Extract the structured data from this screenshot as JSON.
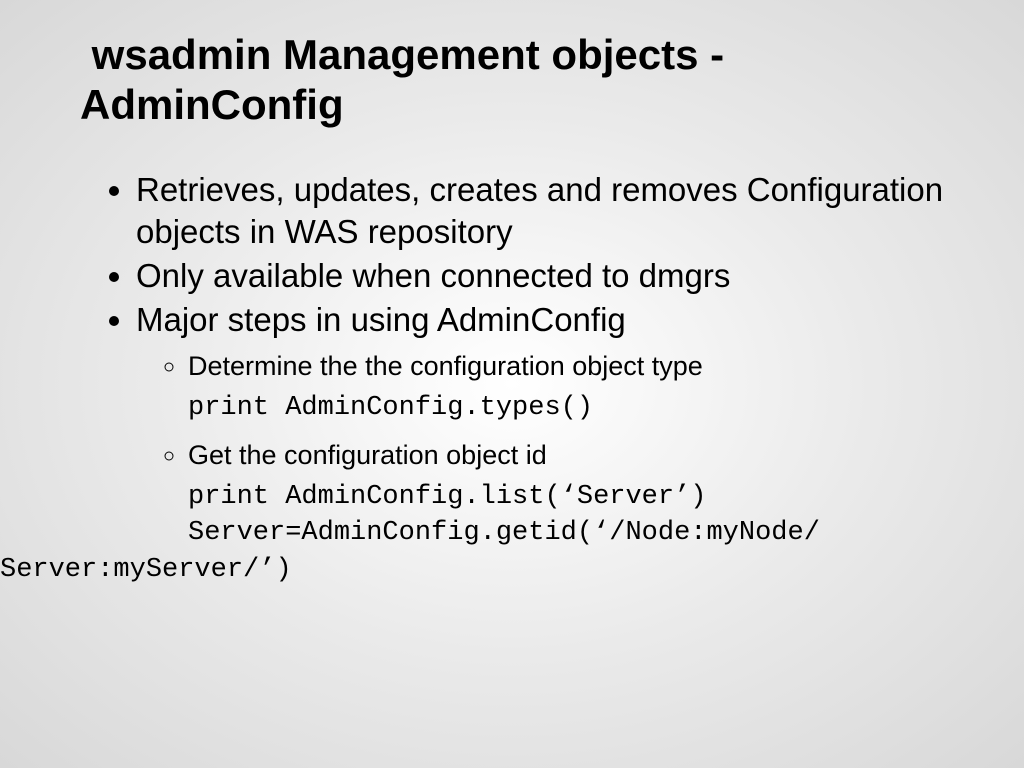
{
  "title_line1": " wsadmin Management objects -",
  "title_line2": "AdminConfig",
  "bullets": {
    "b1": "Retrieves, updates, creates and removes Configuration objects in WAS repository",
    "b2": "Only available when connected to dmgrs",
    "b3": "Major steps in using AdminConfig"
  },
  "sub": {
    "s1": "Determine the the configuration object type",
    "code1": "print AdminConfig.types()",
    "s2": "Get the configuration object id",
    "code2a": "print AdminConfig.list(‘Server’)",
    "code2b": "Server=AdminConfig.getid(‘/Node:myNode/",
    "code2c": "Server:myServer/’)"
  }
}
